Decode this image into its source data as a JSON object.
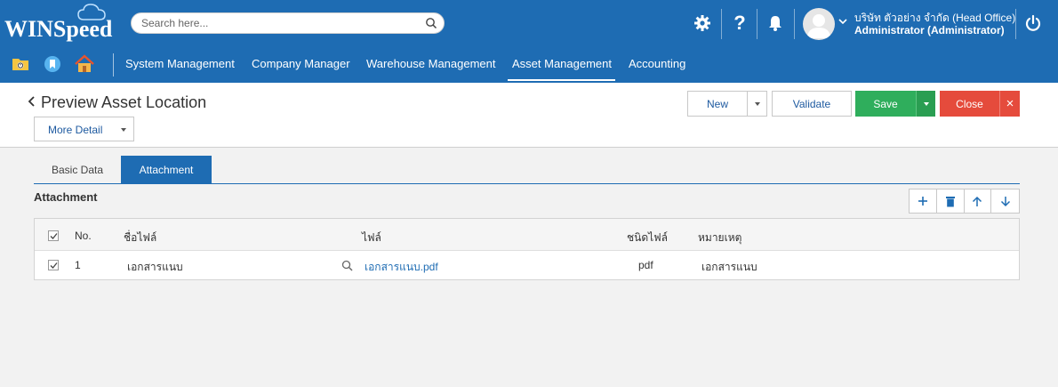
{
  "app": {
    "logo_text": "WINSpeed",
    "search_placeholder": "Search here...",
    "user_company": "บริษัท ตัวอย่าง จำกัด (Head Office)",
    "user_role": "Administrator (Administrator)"
  },
  "icons": {
    "settings": "gear-icon",
    "help": "question-icon",
    "notifications": "bell-icon",
    "power": "power-icon"
  },
  "nav": {
    "items": [
      {
        "label": "System Management"
      },
      {
        "label": "Company Manager"
      },
      {
        "label": "Warehouse Management"
      },
      {
        "label": "Asset Management",
        "active": true
      },
      {
        "label": "Accounting"
      }
    ]
  },
  "page": {
    "title": "Preview Asset Location",
    "more_detail_label": "More Detail"
  },
  "toolbar": {
    "new_label": "New",
    "validate_label": "Validate",
    "save_label": "Save",
    "close_label": "Close",
    "close_x": "×"
  },
  "tabs": [
    {
      "label": "Basic Data",
      "active": false
    },
    {
      "label": "Attachment",
      "active": true
    }
  ],
  "attachment": {
    "section_title": "Attachment",
    "columns": {
      "no": "No.",
      "file_name": "ชื่อไฟล์",
      "file": "ไฟล์",
      "file_type": "ชนิดไฟล์",
      "remark": "หมายเหตุ"
    },
    "rows": [
      {
        "checked": true,
        "no": "1",
        "file_name": "เอกสารแนบ",
        "file": "เอกสารแนบ.pdf",
        "file_type": "pdf",
        "remark": "เอกสารแนบ"
      }
    ]
  },
  "colors": {
    "primary": "#1e6cb3",
    "save": "#2fae5c",
    "close": "#e54b3c",
    "link": "#1e6cb3"
  }
}
